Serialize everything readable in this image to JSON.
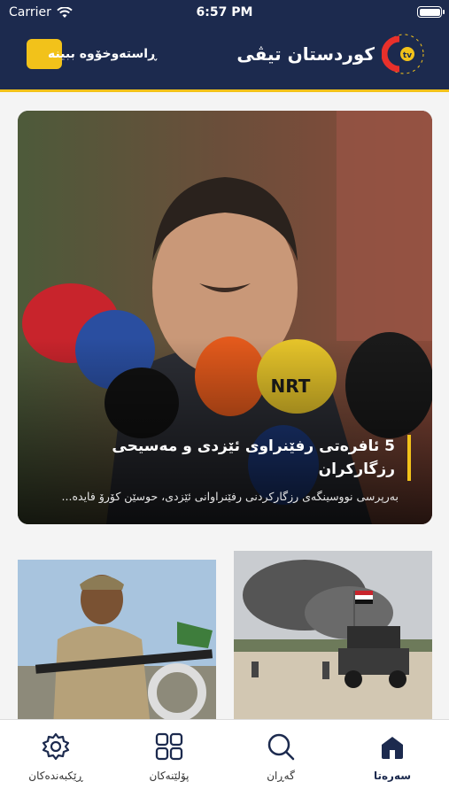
{
  "status": {
    "carrier": "Carrier",
    "time": "6:57 PM"
  },
  "header": {
    "brand_name": "کوردستان تیڤی",
    "live_label": "ڕاستەوخۆوە ببینە",
    "accent_color": "#f2c21a",
    "bg_color": "#1c2a4e"
  },
  "feature": {
    "title": "5 ئافرەتی رفێنراوی ئێزدی و مەسیحی رزگارکران",
    "subtitle": "بەرپرسی نووسینگەی رزگارکردنی رفێنراوانی ئێزدی، حوسێن کۆرۆ فایدە..."
  },
  "tabs": [
    {
      "id": "home",
      "label": "سەرەتا",
      "icon": "home-icon",
      "active": true
    },
    {
      "id": "search",
      "label": "گەڕان",
      "icon": "search-icon",
      "active": false
    },
    {
      "id": "categories",
      "label": "پۆلێنەکان",
      "icon": "grid-icon",
      "active": false
    },
    {
      "id": "settings",
      "label": "ڕێکبەندەکان",
      "icon": "gear-icon",
      "active": false
    }
  ]
}
